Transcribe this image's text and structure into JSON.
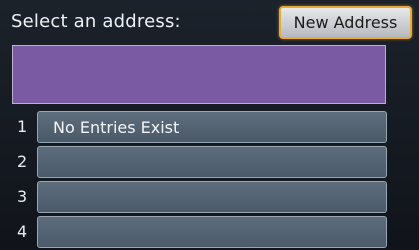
{
  "header": {
    "title": "Select an address:",
    "new_address_label": "New Address"
  },
  "address_field": {
    "value": ""
  },
  "list": {
    "rows": [
      {
        "number": "1",
        "label": "No Entries Exist"
      },
      {
        "number": "2",
        "label": ""
      },
      {
        "number": "3",
        "label": ""
      },
      {
        "number": "4",
        "label": ""
      }
    ]
  },
  "colors": {
    "accent_border": "#e8a93a",
    "address_field": "#7a5aa3",
    "row_button": "#576676",
    "background": "#14181f"
  }
}
